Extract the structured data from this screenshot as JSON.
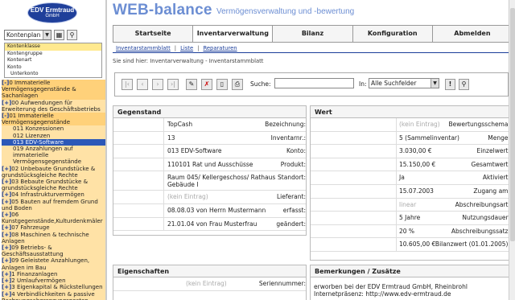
{
  "logo": {
    "line1": "EDV Ermtraud",
    "line2": "GmbH"
  },
  "nav": {
    "select_value": "Kontenplan",
    "options": [
      "Kontenklasse",
      "Kontengruppe",
      "Kontenart",
      "Konto",
      "Unterkonto"
    ],
    "tree": [
      {
        "prefix": "[-]",
        "label": "0 Immaterielle Vermögensgegenstände & Sachanlagen",
        "state": "hl"
      },
      {
        "prefix": "[+]",
        "label": "00 Aufwendungen für Erweiterung des Geschäftsbetriebs",
        "state": ""
      },
      {
        "prefix": "[-]",
        "label": "01 Immaterielle Vermögensgegenstände",
        "state": "hl"
      },
      {
        "prefix": "",
        "label": "011 Konzessionen",
        "state": ""
      },
      {
        "prefix": "",
        "label": "012 Lizenzen",
        "state": ""
      },
      {
        "prefix": "",
        "label": "013 EDV-Software",
        "state": "sel"
      },
      {
        "prefix": "",
        "label": "019 Anzahlungen auf immaterielle Vermögensgegenstände",
        "state": ""
      },
      {
        "prefix": "[+]",
        "label": "02 Unbebaute Grundstücke & grundstücksgleiche Rechte",
        "state": ""
      },
      {
        "prefix": "[+]",
        "label": "03 Bebaute Grundstücke & grundstücksgleiche Rechte",
        "state": ""
      },
      {
        "prefix": "[+]",
        "label": "04 Infrastrukturvermögen",
        "state": ""
      },
      {
        "prefix": "[+]",
        "label": "05 Bauten auf fremdem Grund und Boden",
        "state": ""
      },
      {
        "prefix": "[+]",
        "label": "06 Kunstgegenstände,Kulturdenkmäler",
        "state": ""
      },
      {
        "prefix": "[+]",
        "label": "07 Fahrzeuge",
        "state": ""
      },
      {
        "prefix": "[+]",
        "label": "08 Maschinen & technische Anlagen",
        "state": ""
      },
      {
        "prefix": "[+]",
        "label": "09 Betriebs- & Geschäftsausstattung",
        "state": ""
      },
      {
        "prefix": "[+]",
        "label": "09 Geleistete Anzahlungen, Anlagen im Bau",
        "state": ""
      },
      {
        "prefix": "[+]",
        "label": "1 Finanzanlagen",
        "state": ""
      },
      {
        "prefix": "[+]",
        "label": "2 Umlaufvermögen",
        "state": ""
      },
      {
        "prefix": "[+]",
        "label": "3 Eigenkapital & Rückstellungen",
        "state": ""
      },
      {
        "prefix": "[+]",
        "label": "4 Verbindlichkeiten & passive Rechnungsabgrenzungsposten",
        "state": ""
      }
    ]
  },
  "header": {
    "title": "WEB-balance",
    "subtitle": "Vermögensverwaltung und -bewertung"
  },
  "menu": [
    "Startseite",
    "Inventarverwaltung",
    "Bilanz",
    "Konfiguration",
    "Abmelden"
  ],
  "subnav": [
    "Inventarstammblatt",
    "Liste",
    "Reparaturen"
  ],
  "breadcrumb": "Sie sind hier: Inventarverwaltung - Inventarstammblatt",
  "toolbar": {
    "search_label": "Suche:",
    "search_value": "",
    "in_label": "In:",
    "in_value": "Alle Suchfelder"
  },
  "gegenstand": {
    "title": "Gegenstand",
    "rows": [
      {
        "label": "Bezeichnung:",
        "value": "TopCash",
        "ph": false
      },
      {
        "label": "Inventarnr.:",
        "value": "13",
        "ph": false
      },
      {
        "label": "Konto:",
        "value": "013 EDV-Software",
        "ph": false
      },
      {
        "label": "Produkt:",
        "value": "110101 Rat und Ausschüsse",
        "ph": false
      },
      {
        "label": "Standort:",
        "value": "Raum 045/ Kellergeschoss/ Rathaus Gebäude I",
        "ph": false
      },
      {
        "label": "Lieferant:",
        "value": "(kein Eintrag)",
        "ph": true
      },
      {
        "label": "erfasst:",
        "value": "08.08.03 von Herrn Mustermann",
        "ph": false
      },
      {
        "label": "geändert:",
        "value": "21.01.04 von Frau Musterfrau",
        "ph": false
      }
    ]
  },
  "wert": {
    "title": "Wert",
    "rows": [
      {
        "label": "Bewertungsschema:",
        "value": "(kein Eintrag)",
        "ph": true
      },
      {
        "label": "Menge:",
        "value": "5 (Sammelinventar)",
        "ph": false
      },
      {
        "label": "Einzelwert:",
        "value": "3.030,00 €",
        "ph": false
      },
      {
        "label": "Gesamtwert:",
        "value": "15.150,00 €",
        "ph": false
      },
      {
        "label": "Aktiviert:",
        "value": "Ja",
        "ph": false
      },
      {
        "label": "Zugang am:",
        "value": "15.07.2003",
        "ph": false
      },
      {
        "label": "Abschreibungsart:",
        "value": "linear",
        "ph": true
      },
      {
        "label": "Nutzungsdauer:",
        "value": "5 Jahre",
        "ph": false
      },
      {
        "label": "Abschreibungssatz:",
        "value": "20 %",
        "ph": false
      },
      {
        "label": "Bilanzwert (01.01.2005):",
        "value": "10.605,00 €",
        "ph": false
      }
    ]
  },
  "eigenschaften": {
    "title": "Eigenschaften",
    "rows": [
      {
        "label": "Seriennummer:",
        "value": "(kein Eintrag)",
        "ph": true
      }
    ]
  },
  "bemerkungen": {
    "title": "Bemerkungen / Zusätze",
    "line1": "erworben bei der EDV Ermtraud GmbH, Rheinbrohl",
    "line2": "Internetpräsenz: http://www.edv-ermtraud.de"
  }
}
